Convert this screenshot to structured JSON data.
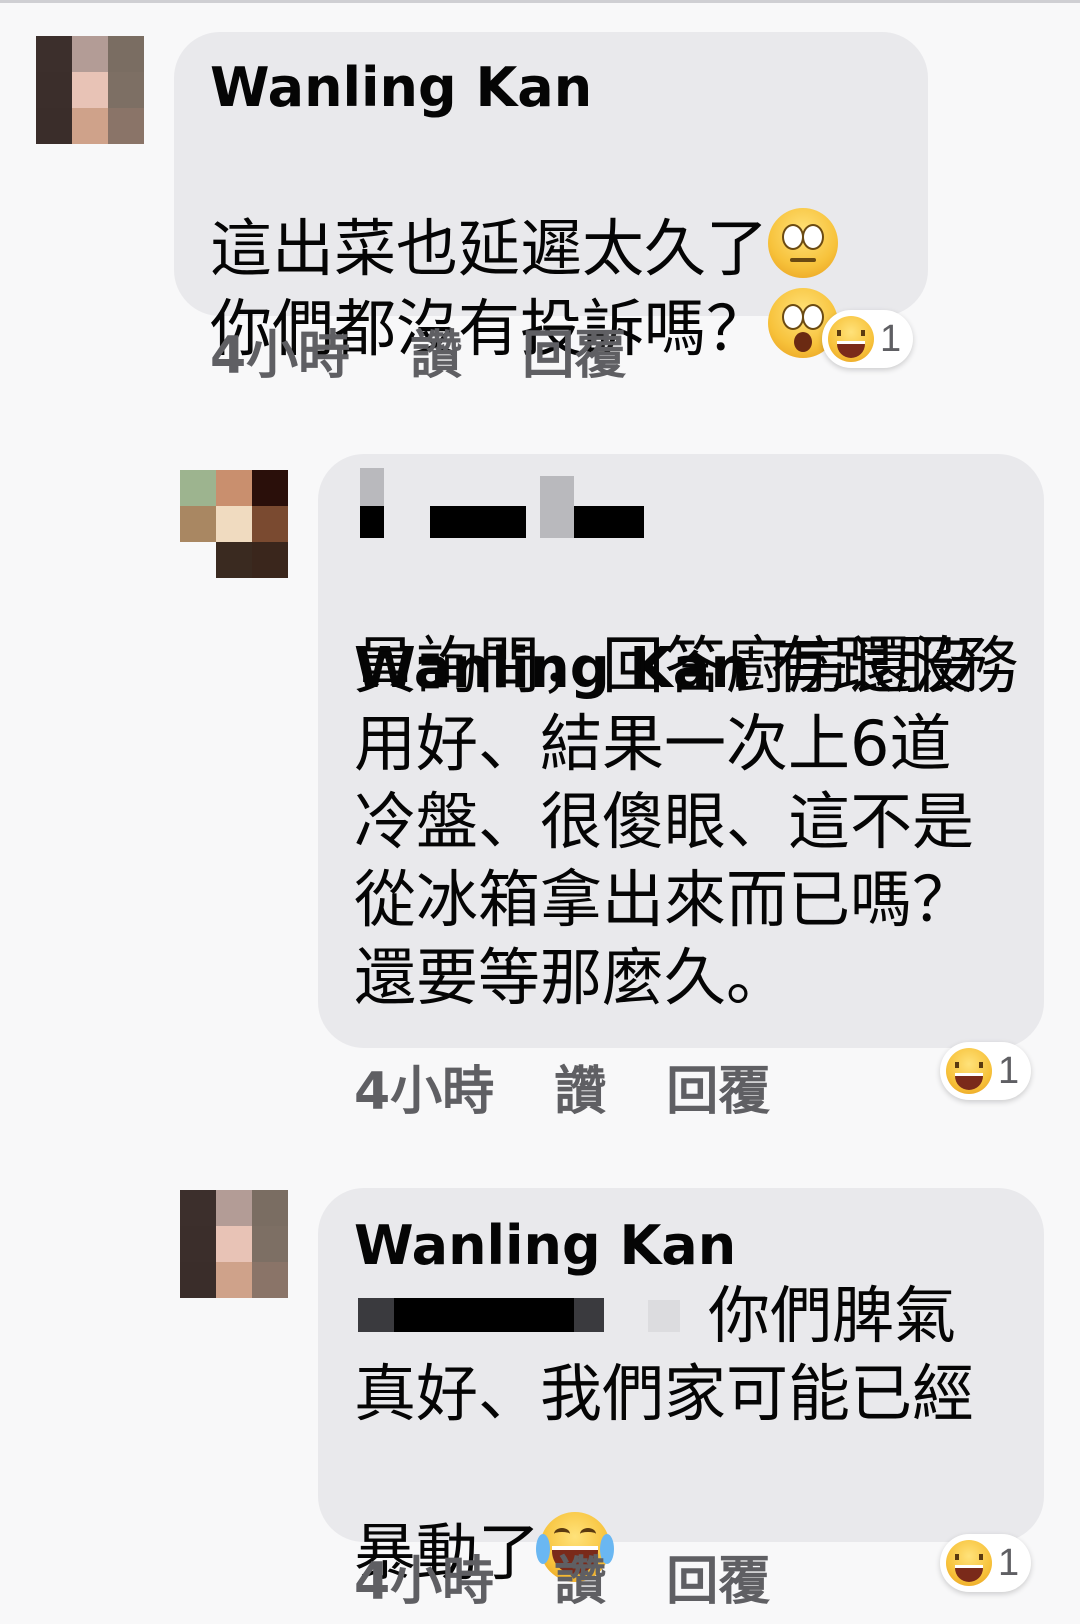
{
  "comments": [
    {
      "author": "Wanling Kan",
      "text_line1": "這出菜也延遲太久了",
      "text_line2": "你們都沒有投訴嗎？",
      "time": "4小時",
      "like": "讚",
      "reply": "回覆",
      "reaction_count": "1",
      "inline_emojis": [
        "face-with-rolling-eyes-emoji",
        "astonished-face-emoji"
      ]
    },
    {
      "author_prefix": "Wanling Kan",
      "text_lines": [
        " 有跟服務",
        "員詢問，回答廚房還沒",
        "用好、結果一次上6道",
        "冷盤、很傻眼、這不是",
        "從冰箱拿出來而已嗎？",
        "還要等那麼久。"
      ],
      "time": "4小時",
      "like": "讚",
      "reply": "回覆",
      "reaction_count": "1"
    },
    {
      "author": "Wanling Kan",
      "text_line1": "你們脾氣",
      "text_line2": "真好、我們家可能已經",
      "text_line3": "暴動了",
      "time": "4小時",
      "like": "讚",
      "reply": "回覆",
      "reaction_count": "1",
      "inline_emojis": [
        "face-with-tears-of-joy-emoji"
      ]
    }
  ],
  "colors": {
    "bubble": "#e9e9ec",
    "meta_text": "#5f5f63",
    "background": "#f8f8f9"
  },
  "reaction_icon": "laughing-squint-emoji"
}
